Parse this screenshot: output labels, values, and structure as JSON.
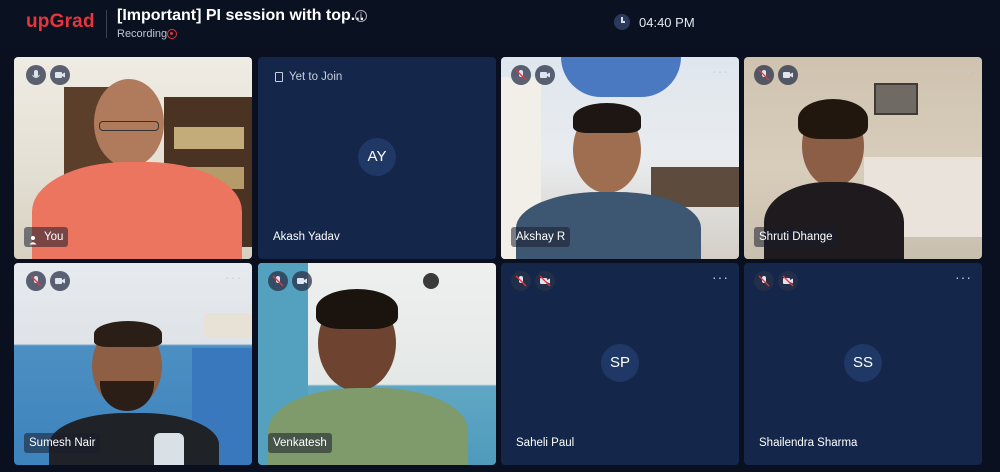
{
  "header": {
    "logo": "upGrad",
    "title": "[Important] PI session with top...",
    "recording_label": "Recording",
    "time": "04:40 PM"
  },
  "participants": [
    {
      "name": "You",
      "status": "",
      "initials": "",
      "video": true,
      "mic_muted": false,
      "cam_off": false
    },
    {
      "name": "Akash Yadav",
      "status": "Yet to Join",
      "initials": "AY",
      "video": false
    },
    {
      "name": "Akshay R",
      "status": "",
      "initials": "",
      "video": true,
      "mic_muted": true,
      "cam_off": false
    },
    {
      "name": "Shruti Dhange",
      "status": "",
      "initials": "",
      "video": true,
      "mic_muted": true,
      "cam_off": false
    },
    {
      "name": "Sumesh Nair",
      "status": "",
      "initials": "",
      "video": true,
      "mic_muted": true,
      "cam_off": false
    },
    {
      "name": "Venkatesh",
      "status": "",
      "initials": "",
      "video": true,
      "mic_muted": true,
      "cam_off": false
    },
    {
      "name": "Saheli Paul",
      "status": "",
      "initials": "SP",
      "video": false,
      "mic_muted": true,
      "cam_off": true
    },
    {
      "name": "Shailendra Sharma",
      "status": "",
      "initials": "SS",
      "video": false,
      "mic_muted": true,
      "cam_off": true
    }
  ],
  "colors": {
    "brand": "#e8343a",
    "tile_bg": "#14264a",
    "page_bg": "#0b1020"
  }
}
